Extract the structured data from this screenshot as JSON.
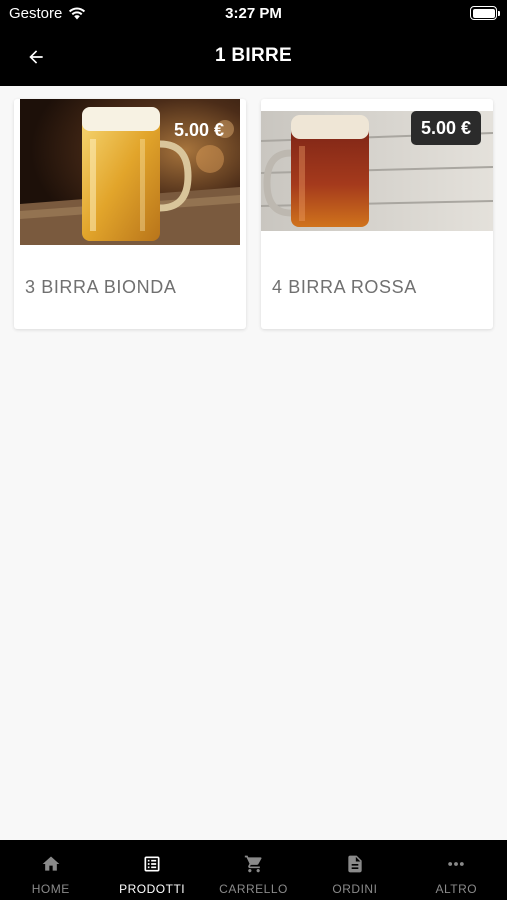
{
  "status_bar": {
    "carrier": "Gestore",
    "time": "3:27 PM",
    "wifi_icon": "wifi-icon",
    "battery_icon": "battery-icon"
  },
  "header": {
    "title": "1 BIRRE",
    "back_icon": "arrow-left-icon"
  },
  "products": [
    {
      "name": "3 BIRRA BIONDA",
      "price": "5.00 €",
      "image": "blonde-beer-mug"
    },
    {
      "name": "4 BIRRA ROSSA",
      "price": "5.00 €",
      "image": "red-beer-mug"
    }
  ],
  "tab_bar": {
    "active": "PRODOTTI",
    "tabs": [
      {
        "label": "HOME",
        "icon": "home-icon"
      },
      {
        "label": "PRODOTTI",
        "icon": "list-icon"
      },
      {
        "label": "CARRELLO",
        "icon": "cart-icon"
      },
      {
        "label": "ORDINI",
        "icon": "document-icon"
      },
      {
        "label": "ALTRO",
        "icon": "more-icon"
      }
    ]
  },
  "colors": {
    "bar": "#000000",
    "background": "#f8f8f8",
    "price_badge": "#2b2b2b",
    "inactive_tab": "#8a8a8a"
  }
}
